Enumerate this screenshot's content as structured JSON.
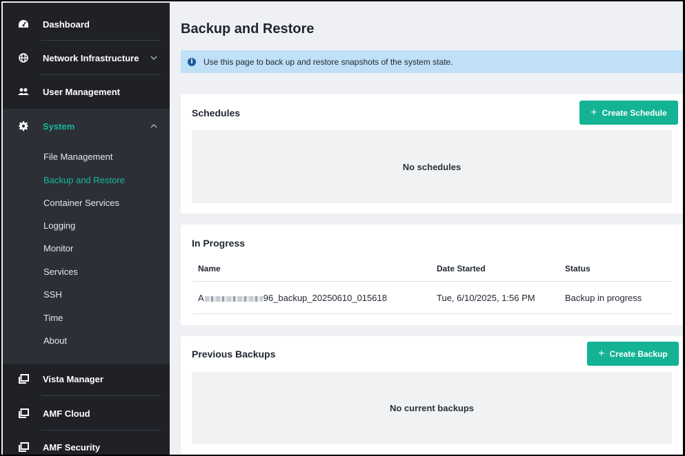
{
  "sidebar": {
    "items": [
      {
        "label": "Dashboard",
        "icon": "dashboard-gauge-icon"
      },
      {
        "label": "Network Infrastructure",
        "icon": "globe-icon"
      },
      {
        "label": "User Management",
        "icon": "users-icon"
      },
      {
        "label": "System",
        "icon": "gear-icon"
      },
      {
        "label": "Vista Manager",
        "icon": "window-icon"
      },
      {
        "label": "AMF Cloud",
        "icon": "window-icon"
      },
      {
        "label": "AMF Security",
        "icon": "window-icon"
      }
    ],
    "system_subitems": [
      {
        "label": "File Management"
      },
      {
        "label": "Backup and Restore"
      },
      {
        "label": "Container Services"
      },
      {
        "label": "Logging"
      },
      {
        "label": "Monitor"
      },
      {
        "label": "Services"
      },
      {
        "label": "SSH"
      },
      {
        "label": "Time"
      },
      {
        "label": "About"
      }
    ],
    "active_subitem": "Backup and Restore"
  },
  "main": {
    "title": "Backup and Restore",
    "info": "Use this page to back up and restore snapshots of the system state.",
    "schedules": {
      "title": "Schedules",
      "button": "Create Schedule",
      "empty": "No schedules"
    },
    "in_progress": {
      "title": "In Progress",
      "columns": [
        "Name",
        "Date Started",
        "Status"
      ],
      "rows": [
        {
          "name_prefix": "A",
          "name_suffix": "96_backup_20250610_015618",
          "date": "Tue, 6/10/2025, 1:56 PM",
          "status": "Backup in progress"
        }
      ]
    },
    "previous_backups": {
      "title": "Previous Backups",
      "button": "Create Backup",
      "empty": "No current backups"
    }
  },
  "colors": {
    "accent": "#13b393",
    "sidebar_bg": "#1f2127",
    "sidebar_expanded_bg": "#2d2f37",
    "info_bg": "#bfe0f6"
  }
}
